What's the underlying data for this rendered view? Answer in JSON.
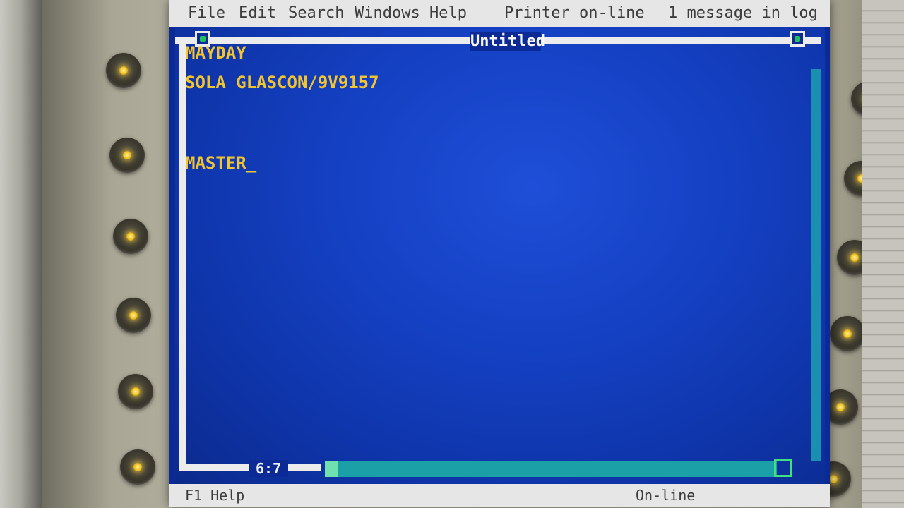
{
  "menubar": {
    "items": [
      {
        "label": "File"
      },
      {
        "label": "Edit"
      },
      {
        "label": "Search"
      },
      {
        "label": "Windows"
      },
      {
        "label": "Help"
      }
    ],
    "printer_status": "Printer on-line",
    "message_status": "1 message in log"
  },
  "window": {
    "title": "Untitled",
    "lines": [
      "MAYDAY",
      "SOLA GLASCON/9V9157",
      "",
      "",
      "MASTER_"
    ],
    "cursor_position": "6:7"
  },
  "statusbar": {
    "left": "F1 Help",
    "right": "On-line"
  },
  "colors": {
    "screen_background": "#0c2a96",
    "text": "#f2c430",
    "chrome": "#e6e6e6",
    "indicator_light": "#f0c020"
  }
}
